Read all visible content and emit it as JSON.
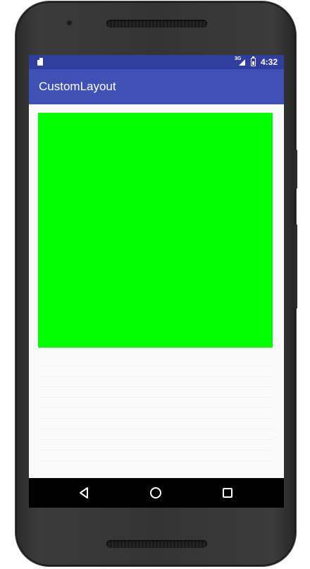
{
  "status_bar": {
    "network_label": "3G",
    "time": "4:32",
    "color": "#303f9f",
    "icons": [
      "sd-card-icon",
      "signal-icon",
      "battery-icon"
    ]
  },
  "app_bar": {
    "title": "CustomLayout",
    "color": "#3f51b5"
  },
  "content": {
    "custom_view_color": "#00ff00",
    "background": "#fafafa"
  },
  "nav_bar": {
    "buttons": [
      "back-icon",
      "home-icon",
      "recents-icon"
    ],
    "color": "#000000"
  }
}
